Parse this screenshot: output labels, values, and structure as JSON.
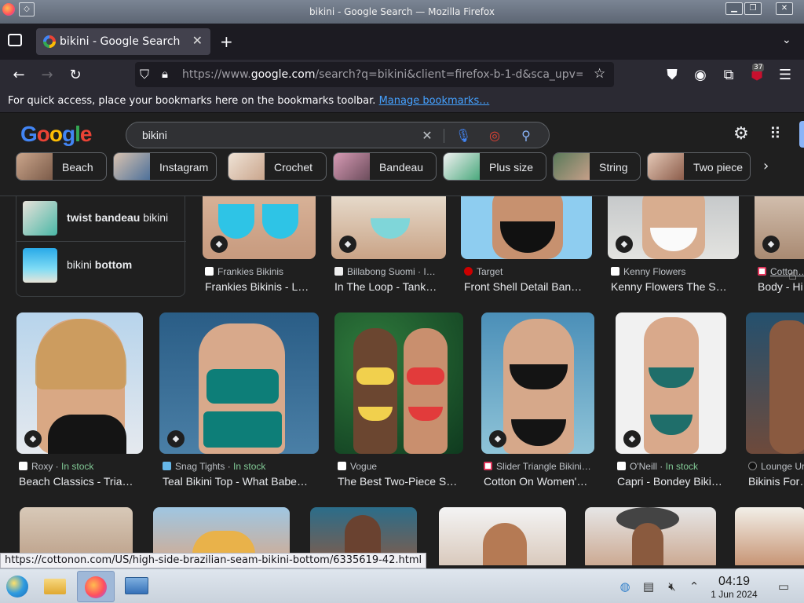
{
  "window": {
    "title": "bikini - Google Search — Mozilla Firefox"
  },
  "tab": {
    "label": "bikini - Google Search",
    "close": "✕",
    "new": "+"
  },
  "nav": {
    "url_prefix": "https://www.",
    "url_domain": "google.com",
    "url_rest": "/search?q=bikini&client=firefox-b-1-d&sca_upv=",
    "extension_badge": "37"
  },
  "bookmarks_bar": {
    "message": "For quick access, place your bookmarks here on the bookmarks toolbar.",
    "link": "Manage bookmarks…"
  },
  "google": {
    "logo": "Google",
    "query": "bikini",
    "chips": [
      {
        "label": "Beach"
      },
      {
        "label": "Instagram"
      },
      {
        "label": "Crochet"
      },
      {
        "label": "Bandeau"
      },
      {
        "label": "Plus size"
      },
      {
        "label": "String"
      },
      {
        "label": "Two piece"
      }
    ]
  },
  "related": [
    {
      "bold": "twist bandeau",
      "rest": " bikini"
    },
    {
      "plain": "bikini ",
      "bold": "bottom"
    }
  ],
  "row1": [
    {
      "source": "Frankies Bikinis",
      "title": "Frankies Bikinis - L…"
    },
    {
      "source": "Billabong Suomi · I…",
      "title": "In The Loop - Tank…"
    },
    {
      "source": "Target",
      "title": "Front Shell Detail Ban…"
    },
    {
      "source": "Kenny Flowers",
      "title": "Kenny Flowers The S…"
    },
    {
      "source": "Cotton…",
      "title": "Body - Hi…"
    }
  ],
  "row2": [
    {
      "source": "Roxy",
      "stock": "In stock",
      "title": "Beach Classics - Tria…"
    },
    {
      "source": "Snag Tights",
      "stock": "In stock",
      "title": "Teal Bikini Top - What Babe…"
    },
    {
      "source": "Vogue",
      "title": "The Best Two-Piece S…"
    },
    {
      "source": "Slider Triangle Bikini…",
      "title": "Cotton On Women'…"
    },
    {
      "source": "O'Neill",
      "stock": "In stock",
      "title": "Capri - Bondey Biki…"
    },
    {
      "source": "Lounge Ur…",
      "title": "Bikinis For…"
    }
  ],
  "status_url": "https://cottonon.com/US/high-side-brazilian-seam-bikini-bottom/6335619-42.html",
  "taskbar": {
    "time": "04:19",
    "date": "1 Jun 2024"
  }
}
